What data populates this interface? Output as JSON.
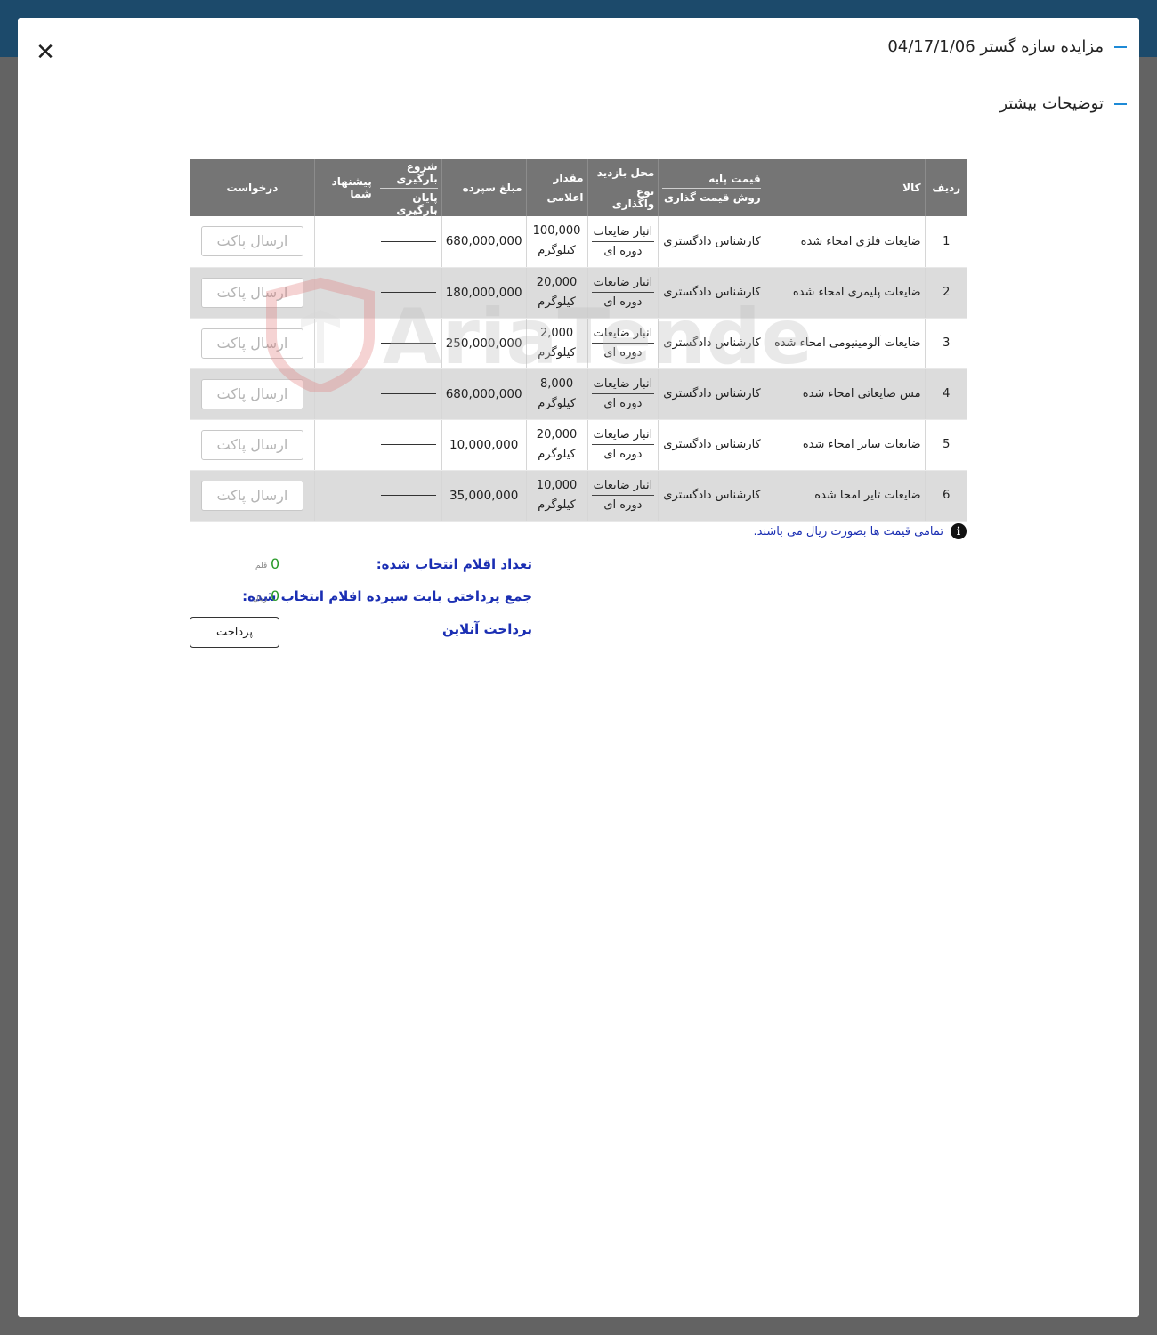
{
  "modal": {
    "title": "مزایده سازه گستر 04/17/1/06",
    "subtitle": "توضیحات بیشتر",
    "close_symbol": "✕"
  },
  "table": {
    "headers": {
      "idx": "ردیف",
      "name": "کالا",
      "base_l1": "قیمت پایه",
      "base_l2": "روش قیمت گذاری",
      "loc_l1": "محل بازدید",
      "loc_l2": "نوع واگذاری",
      "qty": "مقدار اعلامی",
      "deposit": "مبلغ سپرده",
      "load_l1": "شروع بارگیری",
      "load_l2": "پایان بارگیری",
      "offer": "پیشنهاد شما",
      "request": "درخواست"
    },
    "rows": [
      {
        "idx": "1",
        "name": "ضایعات فلزی امحاء شده",
        "base": "کارشناس دادگستری",
        "loc": "انبار ضایعات",
        "type": "دوره ای",
        "qty": "100,000",
        "unit": "کیلوگرم",
        "deposit": "680,000,000",
        "btn": "ارسال پاکت"
      },
      {
        "idx": "2",
        "name": "ضایعات پلیمری امحاء شده",
        "base": "کارشناس دادگستری",
        "loc": "انبار ضایعات",
        "type": "دوره ای",
        "qty": "20,000",
        "unit": "کیلوگرم",
        "deposit": "180,000,000",
        "btn": "ارسال پاکت"
      },
      {
        "idx": "3",
        "name": "ضایعات آلومینیومی امحاء شده",
        "base": "کارشناس دادگستری",
        "loc": "انبار ضایعات",
        "type": "دوره ای",
        "qty": "2,000",
        "unit": "کیلوگرم",
        "deposit": "250,000,000",
        "btn": "ارسال پاکت"
      },
      {
        "idx": "4",
        "name": "مس ضایعاتی امحاء شده",
        "base": "کارشناس دادگستری",
        "loc": "انبار ضایعات",
        "type": "دوره ای",
        "qty": "8,000",
        "unit": "کیلوگرم",
        "deposit": "680,000,000",
        "btn": "ارسال پاکت"
      },
      {
        "idx": "5",
        "name": "ضایعات سایر امحاء شده",
        "base": "کارشناس دادگستری",
        "loc": "انبار ضایعات",
        "type": "دوره ای",
        "qty": "20,000",
        "unit": "کیلوگرم",
        "deposit": "10,000,000",
        "btn": "ارسال پاکت"
      },
      {
        "idx": "6",
        "name": "ضایعات تایر امحا شده",
        "base": "کارشناس دادگستری",
        "loc": "انبار ضایعات",
        "type": "دوره ای",
        "qty": "10,000",
        "unit": "کیلوگرم",
        "deposit": "35,000,000",
        "btn": "ارسال پاکت"
      }
    ]
  },
  "watermark": "AriaTender.neT",
  "note": "تمامی قیمت ها بصورت ریال می باشند.",
  "summary": {
    "count_label": "تعداد اقلام انتخاب شده:",
    "count_value": "0",
    "count_unit": "قلم",
    "total_label": "جمع پرداختی بابت سپرده اقلام انتخاب شده:",
    "total_value": "0",
    "total_unit": "ریال",
    "online_label": "پرداخت آنلاین",
    "pay_button": "پرداخت"
  }
}
